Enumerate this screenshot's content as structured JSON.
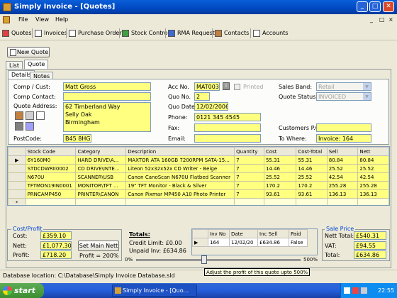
{
  "window": {
    "title": "Simply Invoice - [Quotes]",
    "min": "_",
    "max": "□",
    "close": "✕"
  },
  "menu": {
    "file": "File",
    "view": "View",
    "help": "Help",
    "mdi_min": "_",
    "mdi_max": "□",
    "mdi_close": "×"
  },
  "toolbar": [
    "Quotes",
    "Invoices",
    "Purchase Orders",
    "Stock Control",
    "RMA Request",
    "Contacts",
    "Accounts"
  ],
  "new_quote": "New Quote",
  "outer_tabs": [
    "List",
    "Quote"
  ],
  "inner_tabs": [
    "Details",
    "Notes"
  ],
  "form": {
    "comp_cust_label": "Comp / Cust:",
    "comp_cust": "Matt Gross",
    "comp_contact_label": "Comp Contact:",
    "comp_contact": "",
    "quote_address_label": "Quote Address:",
    "address_lines": [
      "62 Timberland Way",
      "Selly Oak",
      "Birmingham"
    ],
    "postcode_label": "PostCode:",
    "postcode": "B45 8HG",
    "acc_no_label": "Acc No.",
    "acc_no": "MAT003",
    "printed_label": "Printed",
    "quo_no_label": "Quo No.",
    "quo_no": "2",
    "quo_date_label": "Quo Date:",
    "quo_date": "12/02/2006",
    "phone_label": "Phone:",
    "phone": "0121 345 4545",
    "fax_label": "Fax:",
    "fax": "",
    "email_label": "Email:",
    "email": "",
    "sales_band_label": "Sales Band:",
    "sales_band": "Retail",
    "quote_status_label": "Quote Status:",
    "quote_status": "INVOICED",
    "customers_po_label": "Customers P.O:",
    "customers_po": "",
    "to_where_label": "To Where:",
    "to_where": "Invoice: 164"
  },
  "lines": {
    "headers": [
      "Stock Code",
      "Category",
      "Description",
      "Quantity",
      "Cost",
      "Cost-Total",
      "Sell",
      "Nett"
    ],
    "rows": [
      [
        "6Y160M0",
        "HARD DRIVE\\A...",
        "MAXTOR ATA 160GB 7200RPM SATA-15...",
        "7",
        "55.31",
        "55.31",
        "80.84",
        "80.84"
      ],
      [
        "STDCDWRII0002",
        "CD DRIVE\\INTE...",
        "Liteon 52x32x52x CD Writer - Beige",
        "7",
        "14.46",
        "14.46",
        "25.52",
        "25.52"
      ],
      [
        "N670U",
        "SCANNER\\USB",
        "Canon CanoScan N670U Flatbed Scanner",
        "7",
        "25.52",
        "25.52",
        "42.54",
        "42.54"
      ],
      [
        "TFTMON19IN0001",
        "MONITOR\\TFT ...",
        "19\" TFT Monitor - Black & Silver",
        "7",
        "170.2",
        "170.2",
        "255.28",
        "255.28"
      ],
      [
        "PRNCAMP450",
        "PRINTER\\CANON",
        "Canon Pixmar MP450 A10 Photo Printer",
        "7",
        "93.61",
        "93.61",
        "136.13",
        "136.13"
      ]
    ],
    "current_marker": "▶",
    "new_marker": "*"
  },
  "cost_profit": {
    "title": "Cost/Profit",
    "cost_label": "Cost:",
    "cost": "£359.10",
    "nett_label": "Nett:",
    "nett": "£1,077.30",
    "profit_label": "Profit:",
    "profit": "£718.20",
    "set_main_nett": "Set Main Nett",
    "profit_pct": "Profit = 200%"
  },
  "totals": {
    "title": "Totals:",
    "credit_limit": "Credit Limit: £0.00",
    "unpaid_inv": "Unpaid Inv: £634.86"
  },
  "invoices": {
    "headers": [
      "Inv No",
      "Date",
      "Inc Sell",
      "Paid"
    ],
    "row": [
      "164",
      "12/02/20",
      "£634.86",
      "False"
    ]
  },
  "slider": {
    "min": "0%",
    "max": "500%"
  },
  "sale_price": {
    "title": "Sale Price",
    "nett_total_label": "Nett Total:",
    "nett_total": "£540.31",
    "vat_label": "VAT:",
    "vat": "£94.55",
    "total_label": "Total:",
    "total": "£634.86"
  },
  "status": {
    "db_location": "Database location: C:\\Database\\Simply Invoice Database.sld"
  },
  "tooltip": "Adjust the profit of this quote upto 500%",
  "taskbar": {
    "start": "start",
    "task": "Simply Invoice - [Quo...",
    "clock": "22:55"
  }
}
